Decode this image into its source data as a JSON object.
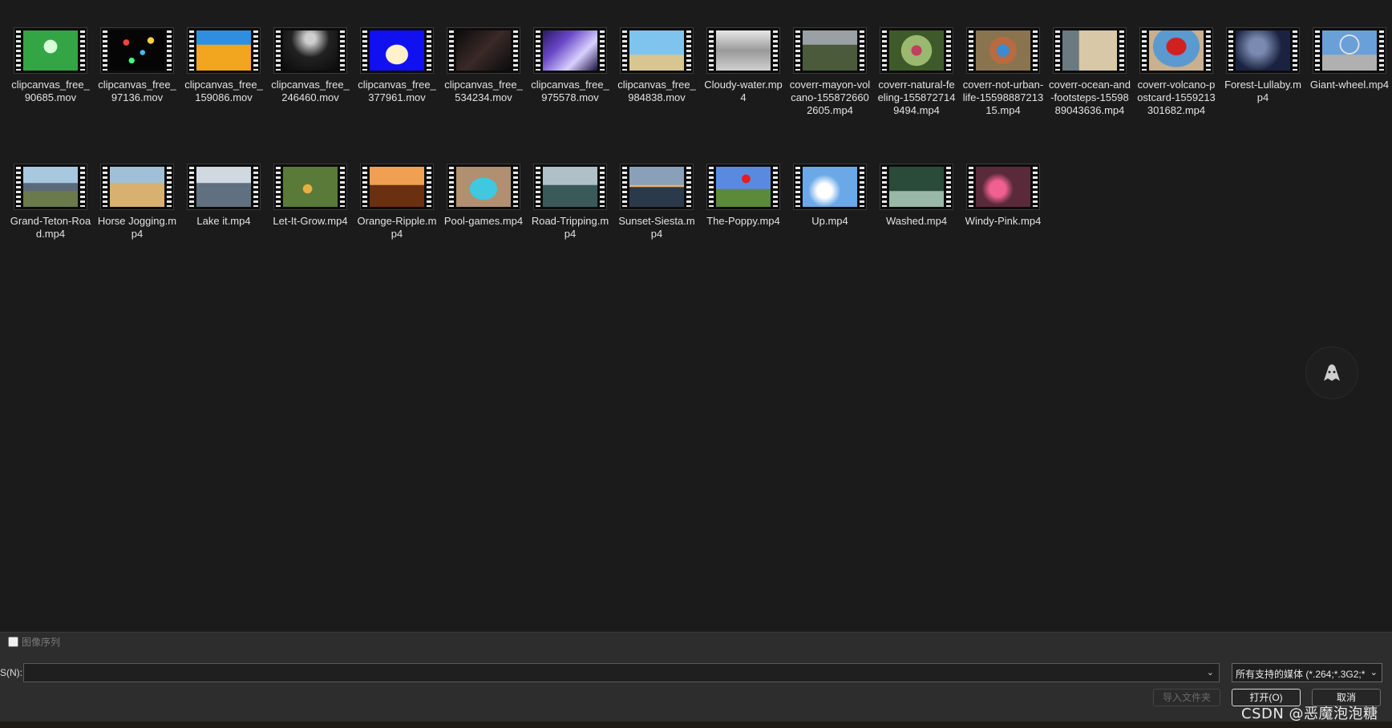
{
  "files": [
    {
      "name": "clipcanvas_free_90685.mov",
      "thumb": "radial-gradient(circle at 50% 40%,#d8ffd8 0 18%,#34a545 19% 100%)"
    },
    {
      "name": "clipcanvas_free_97136.mov",
      "thumb": "radial-gradient(circle at 30% 30%,#ff4040 0 6%,transparent 7%),radial-gradient(circle at 60% 55%,#40c0ff 0 6%,transparent 7%),radial-gradient(circle at 75% 25%,#ffd040 0 6%,transparent 7%),radial-gradient(circle at 40% 75%,#40ff80 0 6%,transparent 7%),#050505"
    },
    {
      "name": "clipcanvas_free_159086.mov",
      "thumb": "linear-gradient(180deg,#2f8ee0 0 35%,#f2a51f 36% 100%)"
    },
    {
      "name": "clipcanvas_free_246460.mov",
      "thumb": "radial-gradient(circle at 50% 20%,#cfcfcf 0 12%,#222 45%,#0a0a0a 100%)"
    },
    {
      "name": "clipcanvas_free_377961.mov",
      "thumb": "radial-gradient(ellipse at 50% 60%,#fff1c8 0 28%,#1010f0 30% 100%)"
    },
    {
      "name": "clipcanvas_free_534234.mov",
      "thumb": "linear-gradient(135deg,#0b0b0b,#3a2a28,#0b0b0b)"
    },
    {
      "name": "clipcanvas_free_975578.mov",
      "thumb": "linear-gradient(135deg,#2a1a60,#6a48c8,#d8d0ff,#1a1040)"
    },
    {
      "name": "clipcanvas_free_984838.mov",
      "thumb": "linear-gradient(180deg,#7fc4ef 0 60%,#d8c590 61% 100%)"
    },
    {
      "name": "Cloudy-water.mp4",
      "thumb": "linear-gradient(180deg,#e8e8e8,#9a9a9a,#d0d0d0)"
    },
    {
      "name": "coverr-mayon-volcano-1558726602605.mp4",
      "thumb": "linear-gradient(180deg,#9aa0a6 0 35%,#4b5a3b 36% 100%)"
    },
    {
      "name": "coverr-natural-feeling-1558727149494.mp4",
      "thumb": "radial-gradient(circle at 50% 50%,#c04060 0 15%,#9ab870 16% 45%,#3e5a2a 46% 100%)"
    },
    {
      "name": "coverr-not-urban-life-1559888721315.mp4",
      "thumb": "radial-gradient(circle at 50% 50%,#3d8ad0 0 18%,#b86a40 19% 40%,#8a7450 41% 100%)"
    },
    {
      "name": "coverr-ocean-and-footsteps-1559889043636.mp4",
      "thumb": "linear-gradient(90deg,#6a7a80 0 30%,#d8c8a8 31% 100%)"
    },
    {
      "name": "coverr-volcano-postcard-1559213301682.mp4",
      "thumb": "radial-gradient(ellipse at 50% 40%,#d02020 0 25%,#5a9ad0 27% 60%,#c8b090 61% 100%)"
    },
    {
      "name": "Forest-Lullaby.mp4",
      "thumb": "radial-gradient(circle at 40% 40%,#7a8ab0 0 20%,#1a2240 60%)"
    },
    {
      "name": "Giant-wheel.mp4",
      "thumb": "radial-gradient(circle at 50% 35%,transparent 0 22%,#e0e0e0 23% 26%,transparent 27%),linear-gradient(180deg,#6aa0d8 0 60%,#b0b0b0 61% 100%)"
    },
    {
      "name": "Grand-Teton-Road.mp4",
      "thumb": "linear-gradient(180deg,#a8c8e0 0 40%,#5a6a7a 41% 60%,#6a7a4a 61% 100%)"
    },
    {
      "name": "Horse Jogging.mp4",
      "thumb": "linear-gradient(180deg,#a0c0d8 0 40%,#d8b070 41% 100%)"
    },
    {
      "name": "Lake it.mp4",
      "thumb": "linear-gradient(180deg,#d0d8e0 0 40%,#607080 41% 100%)"
    },
    {
      "name": "Let-It-Grow.mp4",
      "thumb": "radial-gradient(circle at 45% 55%,#e8b040 0 12%,#5a7a3a 13% 100%)"
    },
    {
      "name": "Orange-Ripple.mp4",
      "thumb": "linear-gradient(180deg,#f0a050 0 45%,#6a3010 46% 100%)"
    },
    {
      "name": "Pool-games.mp4",
      "thumb": "radial-gradient(ellipse at 50% 55%,#40c8e0 0 35%,#b09070 36% 100%)"
    },
    {
      "name": "Road-Tripping.mp4",
      "thumb": "linear-gradient(180deg,#b0c0c8 0 45%,#3a5a5a 46% 100%)"
    },
    {
      "name": "Sunset-Siesta.mp4",
      "thumb": "linear-gradient(180deg,#8aa0b8 0 45%,#e8b070 46% 50%,#2a3a4a 51% 100%)"
    },
    {
      "name": "The-Poppy.mp4",
      "thumb": "radial-gradient(circle at 55% 30%,#e02020 0 10%,transparent 11%),linear-gradient(180deg,#5a8ae0 0 55%,#5a8a3a 56% 100%)"
    },
    {
      "name": "Up.mp4",
      "thumb": "radial-gradient(circle at 40% 60%,#ffffff 0 18%,#6aa8e8 40% 100%)"
    },
    {
      "name": "Washed.mp4",
      "thumb": "linear-gradient(180deg,#2a4a3a 0 60%,#9ab8a8 61% 100%)"
    },
    {
      "name": "Windy-Pink.mp4",
      "thumb": "radial-gradient(circle at 40% 55%,#f06090 0 20%,#5a2a3a 40% 100%)"
    }
  ],
  "bottom": {
    "image_sequence_label": "图像序列",
    "filename_label": "S(N):",
    "filename_value": "",
    "type_select": "所有支持的媒体 (*.264;*.3G2;*",
    "import_folder": "导入文件夹",
    "open": "打开(O)",
    "cancel": "取消"
  },
  "watermark": "CSDN @恶魔泡泡糖"
}
